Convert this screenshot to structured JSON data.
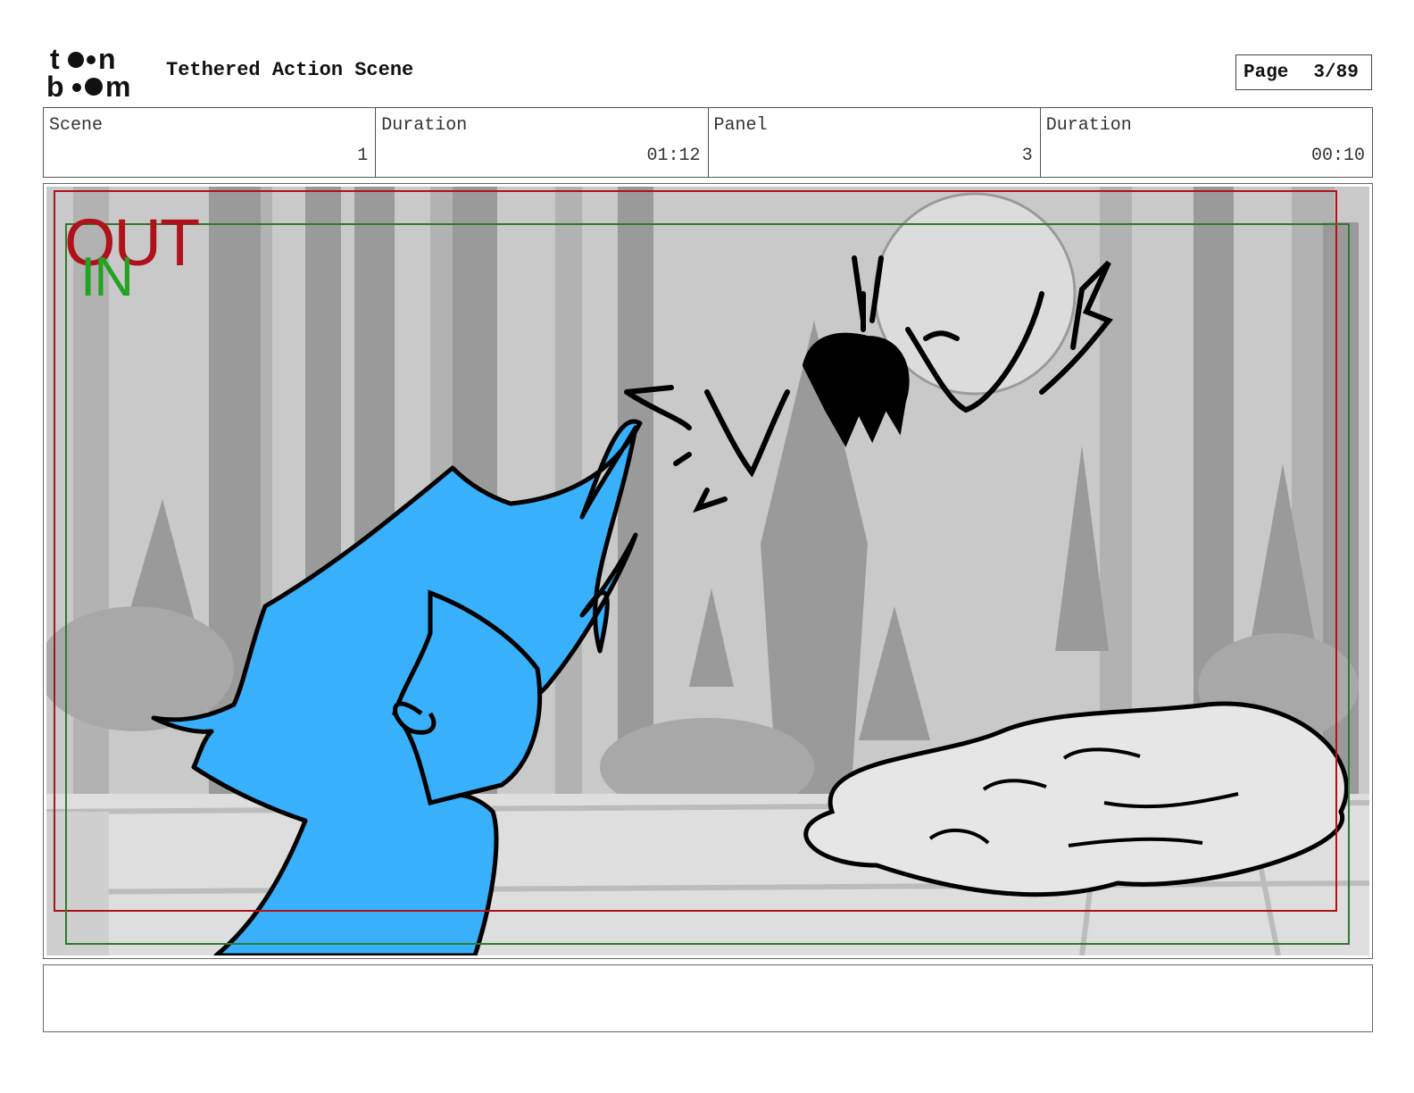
{
  "header": {
    "logo_text": "toon boom",
    "project_title": "Tethered Action Scene",
    "page_label": "Page",
    "page_value": "3/89"
  },
  "info": [
    {
      "label": "Scene",
      "value": "1"
    },
    {
      "label": "Duration",
      "value": "01:12"
    },
    {
      "label": "Panel",
      "value": "3"
    },
    {
      "label": "Duration",
      "value": "00:10"
    }
  ],
  "panel": {
    "safe_area_out_label": "OUT",
    "safe_area_in_label": "IN",
    "out_color": "#b0121b",
    "in_color": "#22a322",
    "character_color": "#38b0fb"
  },
  "notes": {
    "text": ""
  }
}
